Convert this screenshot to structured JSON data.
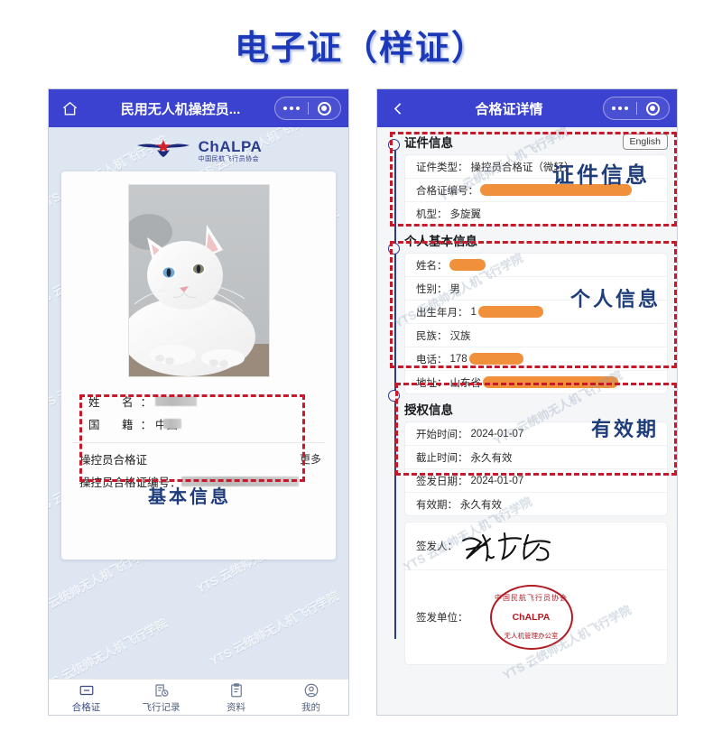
{
  "page": {
    "title": "电子证（样证）",
    "title_color": "#1b39b8",
    "background": "#ffffff",
    "watermark_text": "YTS 云统帅无人机飞行学院"
  },
  "annotations": {
    "accent_color": "#c8192b",
    "label_color": "#1f3d7a",
    "basic_info": "基本信息",
    "cert_info": "证件信息",
    "personal_info": "个人信息",
    "validity": "有效期"
  },
  "left_phone": {
    "navbar": {
      "home_icon": "home-icon",
      "title": "民用无人机操控员...",
      "capsule": {
        "more_icon": "more-dots-icon",
        "target_icon": "circle-target-icon"
      },
      "background": "#3b42cf"
    },
    "brand": {
      "logo_icon": "chalpa-wings-logo",
      "name_en": "ChALPA",
      "name_cn": "中国民航飞行员协会"
    },
    "card": {
      "photo_alt": "白猫证件照",
      "fields": [
        {
          "key": "姓　名",
          "colon": "：",
          "value": "",
          "redacted": true,
          "redact_width": 46
        },
        {
          "key": "国　籍",
          "colon": "：",
          "value": "中国",
          "redacted": true,
          "redact_width": 22
        }
      ],
      "cert_label": "操控员合格证",
      "more_label": "更多",
      "cert_no_label": "操控员合格证编号：",
      "cert_no_value": "",
      "cert_no_redact_width": 130
    },
    "tabbar": [
      {
        "icon": "card-icon",
        "label": "合格证",
        "active": true
      },
      {
        "icon": "flight-log-icon",
        "label": "飞行记录",
        "active": false
      },
      {
        "icon": "document-icon",
        "label": "资料",
        "active": false
      },
      {
        "icon": "user-icon",
        "label": "我的",
        "active": false
      }
    ]
  },
  "right_phone": {
    "navbar": {
      "back_icon": "chevron-left-icon",
      "title": "合格证详情",
      "capsule": {
        "more_icon": "more-dots-icon",
        "target_icon": "circle-target-icon"
      },
      "background": "#3b42cf"
    },
    "sections": [
      {
        "title": "证件信息",
        "action_label": "English",
        "rows": [
          {
            "label": "证件类型：",
            "value": "操控员合格证（微轻）",
            "blob": 0
          },
          {
            "label": "合格证编号：",
            "value": "",
            "blob": 168
          },
          {
            "label": "机型：",
            "value": "多旋翼",
            "blob": 0
          }
        ]
      },
      {
        "title": "个人基本信息",
        "action_label": "",
        "rows": [
          {
            "label": "姓名：",
            "value": "",
            "blob": 40
          },
          {
            "label": "性别：",
            "value": "男",
            "blob": 0
          },
          {
            "label": "出生年月：",
            "value": "1",
            "blob": 72
          },
          {
            "label": "民族：",
            "value": "汉族",
            "blob": 0
          },
          {
            "label": "电话：",
            "value": "178",
            "blob": 60
          },
          {
            "label": "地址：",
            "value": "山东省",
            "blob": 152
          }
        ]
      },
      {
        "title": "授权信息",
        "action_label": "",
        "rows": [
          {
            "label": "开始时间：",
            "value": "2024-01-07",
            "blob": 0
          },
          {
            "label": "截止时间：",
            "value": "永久有效",
            "blob": 0
          },
          {
            "label": "签发日期：",
            "value": "2024-01-07",
            "blob": 0
          },
          {
            "label": "有效期：",
            "value": "永久有效",
            "blob": 0
          }
        ]
      }
    ],
    "signature": {
      "issuer_label": "签发人：",
      "issuer_signature_alt": "手写签名",
      "org_label": "签发单位：",
      "seal": {
        "text_cn": "中国民航飞行员协会",
        "text_en": "ChALPA",
        "text_bottom": "无人机管理办公室",
        "color": "#b01b22"
      }
    }
  }
}
